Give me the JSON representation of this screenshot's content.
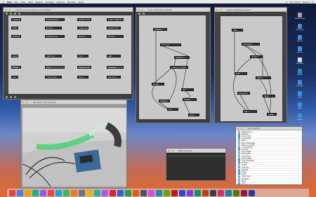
{
  "menubar": {
    "app_name": "Max",
    "items": [
      "File",
      "Edit",
      "View",
      "Object",
      "Arrange",
      "Options",
      "Window",
      "Help"
    ],
    "clock": "Thu 12:27",
    "user": "xiaoou"
  },
  "windows": {
    "patcher1": {
      "title": "bitalino_r-iot_arduino_osc.maxpat"
    },
    "patcher2": {
      "title": "hue_controller.maxpat"
    },
    "patcher3": {
      "title": "light_mapping.maxpat"
    },
    "webcam": {
      "title": "FaceTime HD Camera"
    },
    "console": {
      "title": "Max Console"
    },
    "finder": {
      "title": "Documents"
    }
  },
  "patcher1_objects": [
    "udpreceive 8888",
    "route /bitalino",
    "unpack 0 0 0",
    "scale 0 1023 0. 1.",
    "slide 10 10",
    "flonum",
    "route /riot",
    "unpack f f f",
    "zl.group 3",
    "prepend pos",
    "flonum",
    "flonum",
    "serial a 9600",
    "metro 20",
    "t b b",
    "gate",
    "toggle",
    "print",
    "prepend set",
    "message",
    "s to_hue",
    "r from_ardu",
    "line 0.",
    "pak 0 0 0"
  ],
  "patcher2_objects": [
    "loadbang",
    "r to_hue",
    "route bri",
    "scale 0. 1. 0 254",
    "jit.uldl",
    "dict",
    "prepend",
    "sprintf",
    "t b l",
    "print"
  ],
  "patcher3_objects": [
    "inlet",
    "route light",
    "unpack",
    "expr",
    "gate 2",
    "maximum",
    "mtof",
    "dac~",
    "outlet"
  ],
  "finder_items": [
    "Applications",
    "Desktop",
    "Documents",
    "Downloads",
    "Max 7",
    "Max 8 Packages",
    "bitalino_project",
    "r-iot_patches",
    "Arduino",
    "hue_bridge",
    "OSC_tests",
    "recordings",
    "screenshots",
    "max_examples",
    "archive",
    "notes",
    "sketches",
    "exports",
    "library",
    "build",
    "resources",
    "samples",
    "temp",
    "misc"
  ],
  "desktop_icons": [
    {
      "label": "Macintosh HD",
      "color": "#9aa3ad"
    },
    {
      "label": "Documents",
      "color": "#3b8fd6"
    },
    {
      "label": "Projects",
      "color": "#3b8fd6"
    },
    {
      "label": "patches",
      "color": "#3b8fd6"
    },
    {
      "label": "Screenshot",
      "color": "#d9d9d9"
    },
    {
      "label": "Arduino",
      "color": "#1f9aa5"
    },
    {
      "label": "max_files",
      "color": "#3b8fd6"
    },
    {
      "label": "audio",
      "color": "#3b8fd6"
    },
    {
      "label": "video",
      "color": "#3b8fd6"
    },
    {
      "label": "archive",
      "color": "#3b8fd6"
    }
  ],
  "dock_colors": [
    "#e2473b",
    "#3b82f6",
    "#f59e0b",
    "#10b981",
    "#8b5cf6",
    "#ef4444",
    "#0ea5e9",
    "#22c55e",
    "#f97316",
    "#64748b",
    "#eab308",
    "#14b8a6",
    "#a855f7",
    "#dc2626",
    "#2563eb",
    "#16a34a",
    "#ea580c",
    "#475569",
    "#d946ef",
    "#0891b2",
    "#65a30d",
    "#b91c1c",
    "#1d4ed8",
    "#7c3aed",
    "#059669",
    "#c2410c",
    "#334155",
    "#db2777",
    "#0284c7",
    "#4d7c0f",
    "#9f1239",
    "#1e40af"
  ]
}
